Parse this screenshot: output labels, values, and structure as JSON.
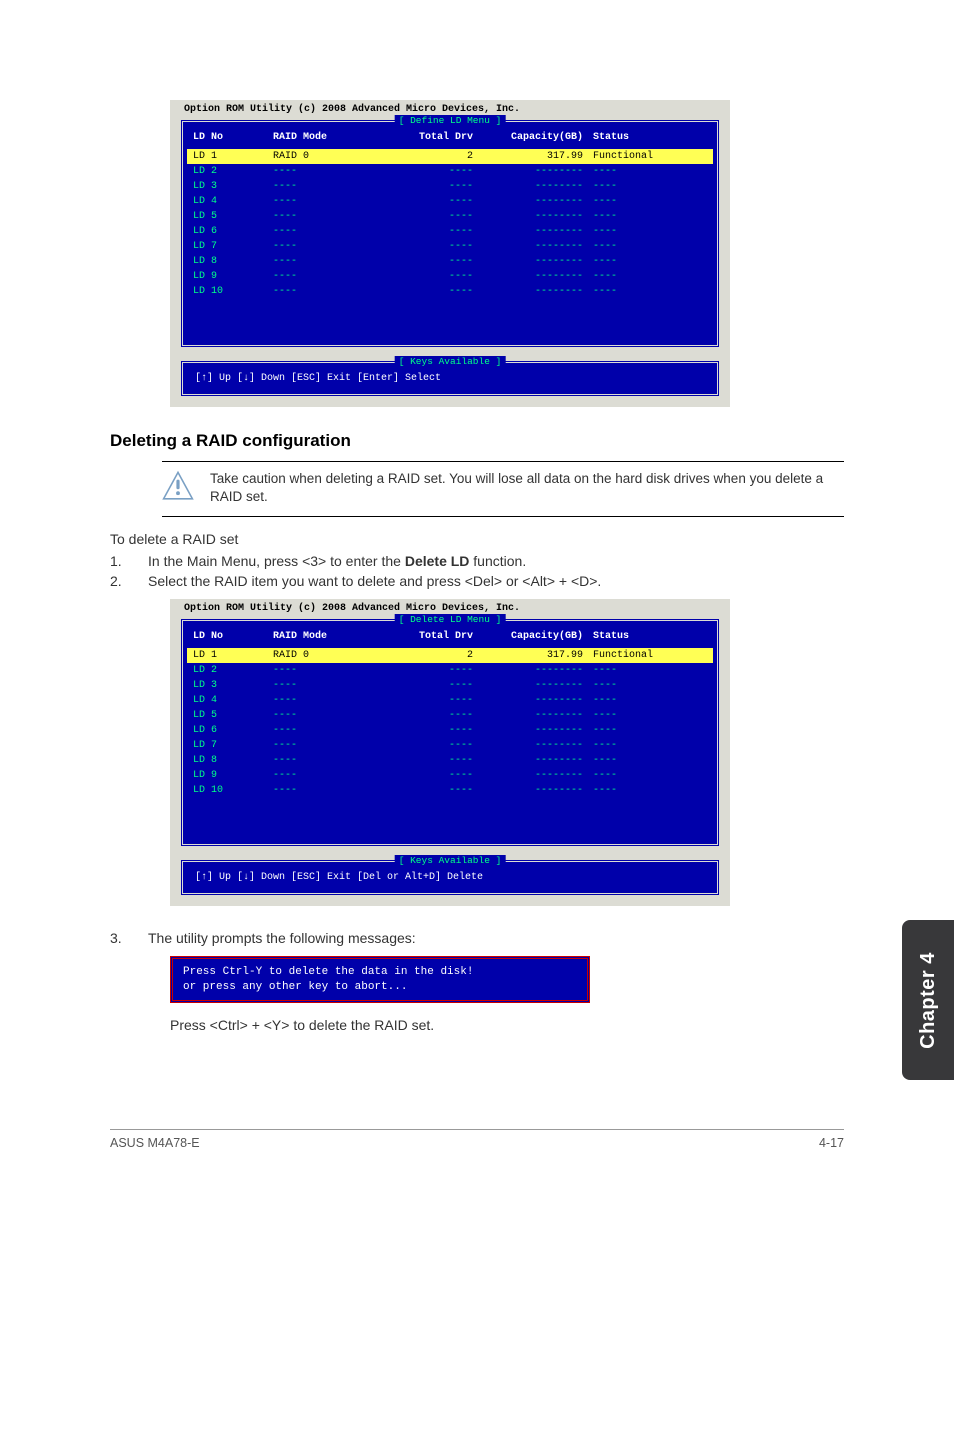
{
  "bios": {
    "utility_title": "Option ROM Utility (c) 2008 Advanced Micro Devices, Inc.",
    "define_menu_label": "[ Define LD Menu ]",
    "delete_menu_label": "[ Delete LD Menu ]",
    "keys_label": "[ Keys Available ]",
    "headers": {
      "ldno": "LD No",
      "raid_mode": "RAID Mode",
      "total_drv": "Total Drv",
      "capacity": "Capacity(GB)",
      "status": "Status"
    },
    "rows": [
      {
        "ldno": "LD 1",
        "mode": "RAID 0",
        "drv": "2",
        "cap": "317.99",
        "stat": "Functional",
        "highlight": true
      },
      {
        "ldno": "LD 2",
        "mode": "----",
        "drv": "----",
        "cap": "--------",
        "stat": "----"
      },
      {
        "ldno": "LD 3",
        "mode": "----",
        "drv": "----",
        "cap": "--------",
        "stat": "----"
      },
      {
        "ldno": "LD 4",
        "mode": "----",
        "drv": "----",
        "cap": "--------",
        "stat": "----"
      },
      {
        "ldno": "LD 5",
        "mode": "----",
        "drv": "----",
        "cap": "--------",
        "stat": "----"
      },
      {
        "ldno": "LD 6",
        "mode": "----",
        "drv": "----",
        "cap": "--------",
        "stat": "----"
      },
      {
        "ldno": "LD 7",
        "mode": "----",
        "drv": "----",
        "cap": "--------",
        "stat": "----"
      },
      {
        "ldno": "LD 8",
        "mode": "----",
        "drv": "----",
        "cap": "--------",
        "stat": "----"
      },
      {
        "ldno": "LD 9",
        "mode": "----",
        "drv": "----",
        "cap": "--------",
        "stat": "----"
      },
      {
        "ldno": "LD 10",
        "mode": "----",
        "drv": "----",
        "cap": "--------",
        "stat": "----"
      }
    ],
    "keys_define": "[↑] Up [↓] Down [ESC] Exit [Enter] Select",
    "keys_delete": "[↑] Up [↓] Down [ESC] Exit [Del or Alt+D] Delete"
  },
  "doc": {
    "heading": "Deleting a RAID configuration",
    "note": "Take caution when deleting a RAID set. You will lose all data on the hard disk drives when you delete a RAID set.",
    "intro": "To delete a RAID set",
    "step1_pre": "In the Main Menu, press <3> to enter the ",
    "step1_bold": "Delete LD",
    "step1_post": " function.",
    "step2": "Select the RAID item you want to delete and press <Del> or <Alt> + <D>.",
    "step3": "The utility prompts the following messages:",
    "prompt_line1": "Press Ctrl-Y to delete the data in the disk!",
    "prompt_line2": "or press any other key to abort...",
    "press_line": "Press <Ctrl> + <Y> to delete the RAID set.",
    "side_tab": "Chapter 4",
    "footer_left": "ASUS M4A78-E",
    "footer_right": "4-17"
  }
}
